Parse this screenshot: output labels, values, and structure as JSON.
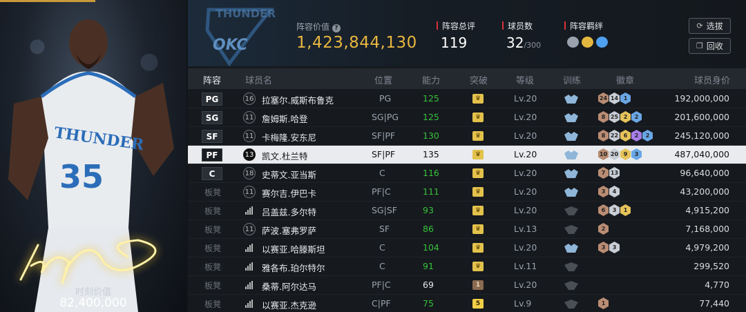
{
  "left_panel": {
    "label": "时刻价值",
    "value": "82,400,000",
    "jersey_team": "THUNDER",
    "jersey_number": "35"
  },
  "header": {
    "team_logo": "OKC",
    "lineup_value_label": "阵容价值",
    "lineup_value": "1,423,844,130",
    "rating_label": "阵容总评",
    "rating": "119",
    "players_label": "球员数",
    "players": "32",
    "players_max": "/300",
    "bond_label": "阵容羁绊",
    "select_button": "选拔",
    "recycle_button": "回收",
    "accent": "#d8323c",
    "value_color": "#e9b640"
  },
  "columns": {
    "lineup": "阵容",
    "name": "球员名",
    "position": "位置",
    "ability": "能力",
    "breakthrough": "突破",
    "level": "等级",
    "training": "训练",
    "badges": "徽章",
    "value": "球员身价"
  },
  "rows": [
    {
      "slot": "PG",
      "bench": false,
      "num": "16",
      "name": "拉塞尔.威斯布鲁克",
      "pos": "PG",
      "ability": "125",
      "green": true,
      "crown": "",
      "level": "Lv.20",
      "train": true,
      "badges": [
        [
          "bronze",
          "24"
        ],
        [
          "silver",
          "14"
        ],
        [
          "blue",
          "1"
        ]
      ],
      "value": "192,000,000",
      "selected": false
    },
    {
      "slot": "SG",
      "bench": false,
      "num": "11",
      "name": "詹姆斯.哈登",
      "pos": "SG|PG",
      "ability": "125",
      "green": true,
      "crown": "",
      "level": "Lv.20",
      "train": true,
      "badges": [
        [
          "bronze",
          "8"
        ],
        [
          "silver",
          "25"
        ],
        [
          "gold",
          "2"
        ],
        [
          "blue",
          "2"
        ]
      ],
      "value": "201,600,000",
      "selected": false
    },
    {
      "slot": "SF",
      "bench": false,
      "num": "11",
      "name": "卡梅隆.安东尼",
      "pos": "SF|PF",
      "ability": "130",
      "green": true,
      "crown": "",
      "level": "Lv.20",
      "train": true,
      "badges": [
        [
          "bronze",
          "8"
        ],
        [
          "silver",
          "22"
        ],
        [
          "gold",
          "6"
        ],
        [
          "purple",
          "2"
        ],
        [
          "blue",
          "2"
        ]
      ],
      "value": "245,120,000",
      "selected": false
    },
    {
      "slot": "PF",
      "bench": false,
      "num": "13",
      "name": "凯文.杜兰特",
      "pos": "SF|PF",
      "ability": "135",
      "green": false,
      "crown": "",
      "level": "Lv.20",
      "train": true,
      "badges": [
        [
          "bronze",
          "10"
        ],
        [
          "silver",
          "20"
        ],
        [
          "gold",
          "9"
        ],
        [
          "blue",
          "3"
        ]
      ],
      "value": "487,040,000",
      "selected": true
    },
    {
      "slot": "C",
      "bench": false,
      "num": "18",
      "name": "史蒂文.亚当斯",
      "pos": "C",
      "ability": "116",
      "green": true,
      "crown": "",
      "level": "Lv.20",
      "train": true,
      "badges": [
        [
          "bronze",
          "7"
        ],
        [
          "silver",
          "13"
        ]
      ],
      "value": "96,640,000",
      "selected": false
    },
    {
      "slot": "板凳",
      "bench": true,
      "num": "11",
      "name": "赛尔吉.伊巴卡",
      "pos": "PF|C",
      "ability": "111",
      "green": true,
      "crown": "",
      "level": "Lv.20",
      "train": true,
      "badges": [
        [
          "bronze",
          "3"
        ],
        [
          "silver",
          "4"
        ]
      ],
      "value": "43,200,000",
      "selected": false
    },
    {
      "slot": "板凳",
      "bench": true,
      "num": "sig",
      "name": "吕盖兹.多尔特",
      "pos": "SG|SF",
      "ability": "93",
      "green": true,
      "crown": "",
      "level": "Lv.20",
      "train": false,
      "badges": [
        [
          "bronze",
          "6"
        ],
        [
          "silver",
          "3"
        ],
        [
          "gold",
          "1"
        ]
      ],
      "value": "4,915,200",
      "selected": false
    },
    {
      "slot": "板凳",
      "bench": true,
      "num": "11",
      "name": "萨波.塞弗罗萨",
      "pos": "SF",
      "ability": "86",
      "green": true,
      "crown": "",
      "level": "Lv.13",
      "train": false,
      "badges": [
        [
          "bronze",
          "2"
        ]
      ],
      "value": "7,168,000",
      "selected": false
    },
    {
      "slot": "板凳",
      "bench": true,
      "num": "sig",
      "name": "以赛亚.哈滕斯坦",
      "pos": "C",
      "ability": "104",
      "green": true,
      "crown": "",
      "level": "Lv.20",
      "train": true,
      "badges": [
        [
          "bronze",
          "3"
        ],
        [
          "silver",
          "3"
        ]
      ],
      "value": "4,979,200",
      "selected": false
    },
    {
      "slot": "板凳",
      "bench": true,
      "num": "sig",
      "name": "雅各布.珀尔特尔",
      "pos": "C",
      "ability": "91",
      "green": true,
      "crown": "",
      "level": "Lv.11",
      "train": false,
      "badges": [],
      "value": "299,520",
      "selected": false
    },
    {
      "slot": "板凳",
      "bench": true,
      "num": "sig",
      "name": "桑蒂.阿尔达马",
      "pos": "PF|C",
      "ability": "69",
      "green": false,
      "crown": "1",
      "level": "Lv.20",
      "train": false,
      "badges": [],
      "value": "4,770",
      "selected": false
    },
    {
      "slot": "板凳",
      "bench": true,
      "num": "sig",
      "name": "以赛亚.杰克逊",
      "pos": "C|PF",
      "ability": "75",
      "green": true,
      "crown": "5",
      "level": "Lv.9",
      "train": false,
      "badges": [
        [
          "bronze",
          "1"
        ]
      ],
      "value": "77,440",
      "selected": false
    }
  ]
}
